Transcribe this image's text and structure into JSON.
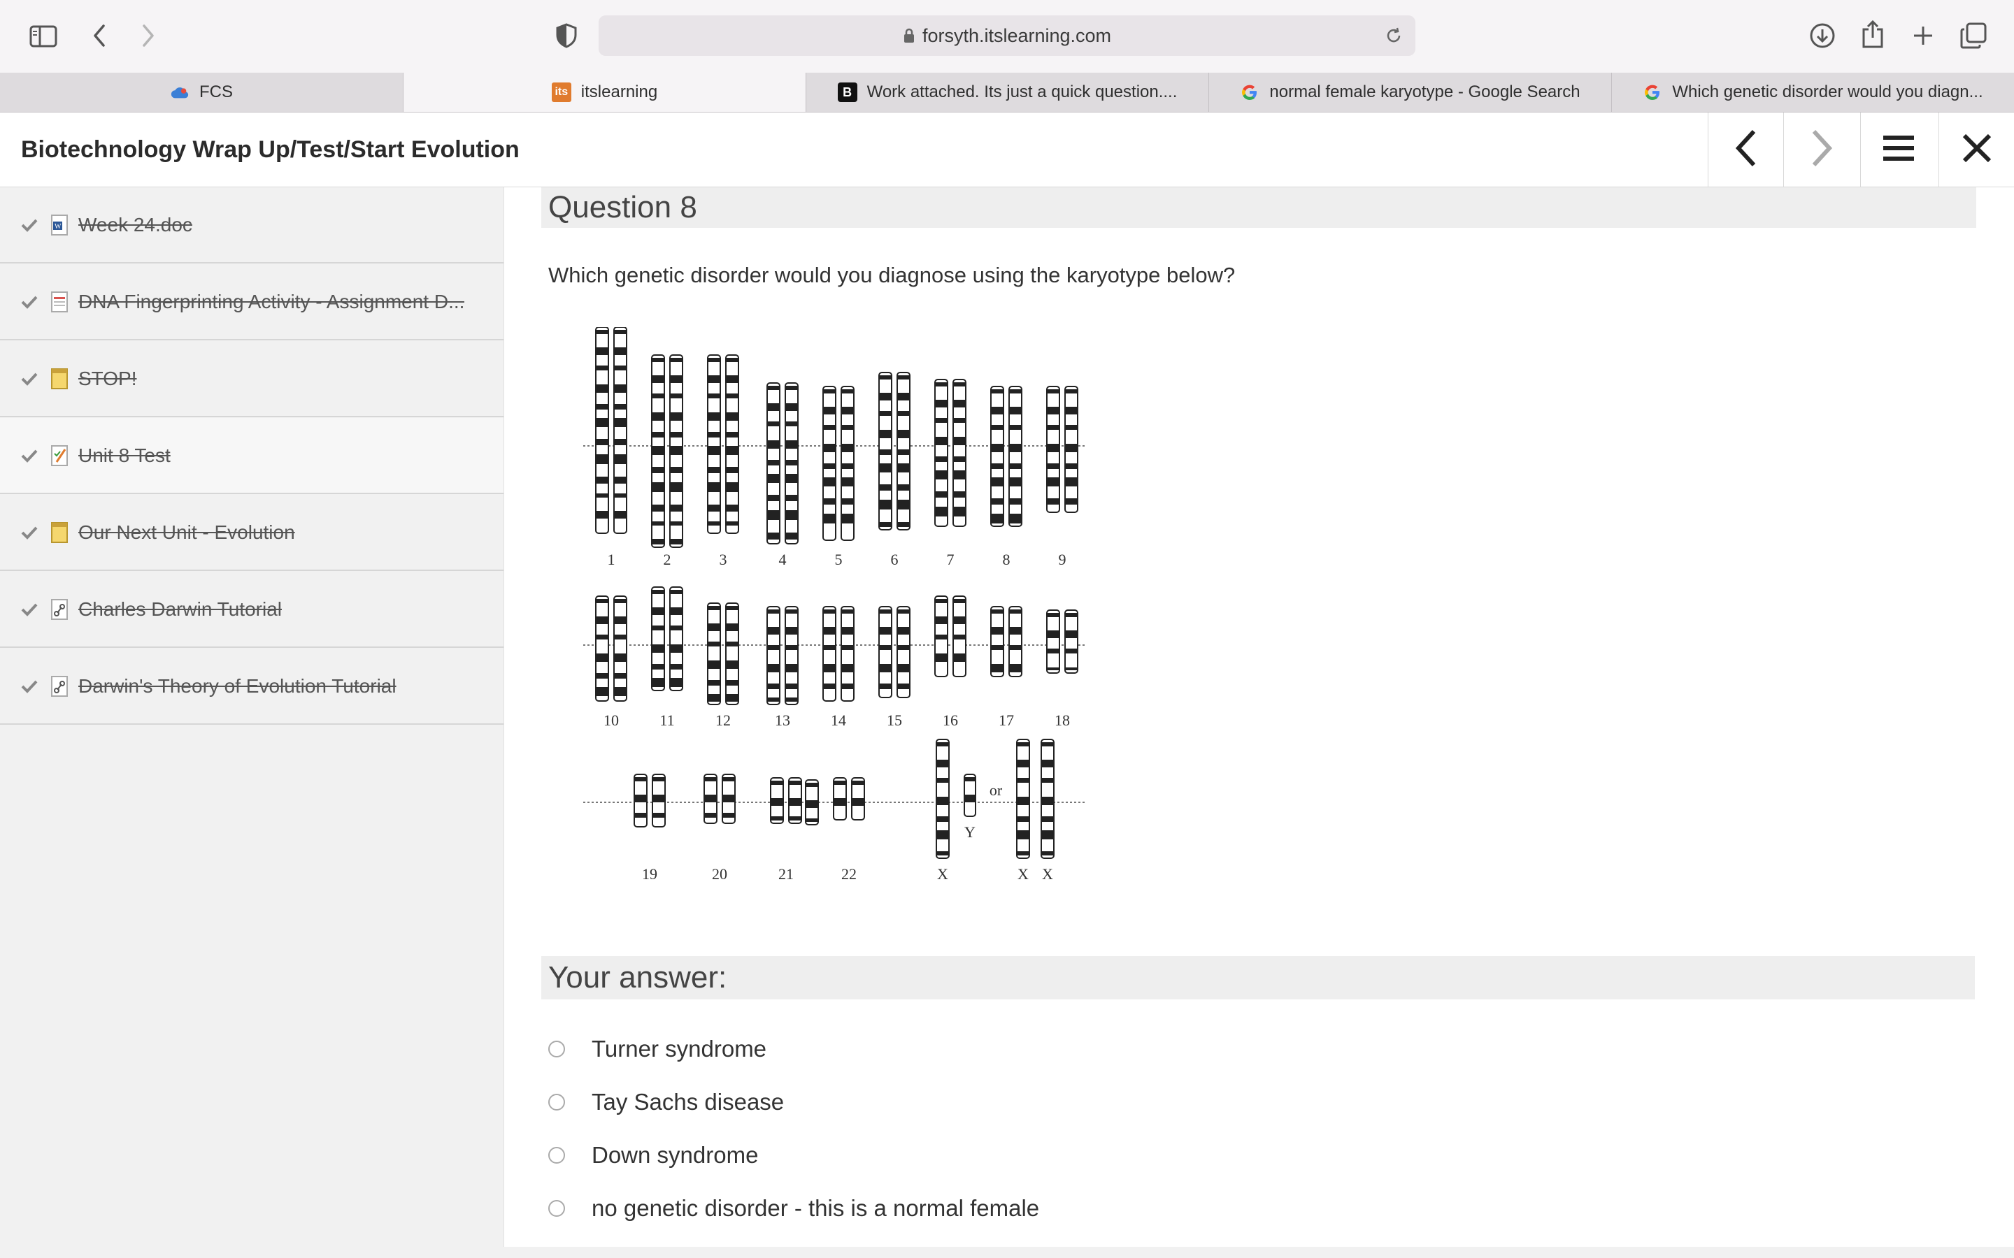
{
  "browser": {
    "url": "forsyth.itslearning.com",
    "tabs": [
      {
        "label": "FCS",
        "icon": "cloud-icon"
      },
      {
        "label": "itslearning",
        "icon": "itslearning-icon",
        "active": true
      },
      {
        "label": "Work attached. Its just a quick question....",
        "icon": "brainly-icon"
      },
      {
        "label": "normal female karyotype - Google Search",
        "icon": "google-icon"
      },
      {
        "label": "Which genetic disorder would you diagn...",
        "icon": "google-icon"
      }
    ]
  },
  "header": {
    "title": "Biotechnology Wrap Up/Test/Start Evolution"
  },
  "sidebar": {
    "items": [
      {
        "label": "Week 24.doc",
        "icon": "word-doc-icon",
        "completed": true
      },
      {
        "label": "DNA Fingerprinting Activity - Assignment D...",
        "icon": "pdf-doc-icon",
        "completed": true
      },
      {
        "label": "STOP!",
        "icon": "note-icon",
        "completed": true
      },
      {
        "label": "Unit 8 Test",
        "icon": "test-icon",
        "completed": true
      },
      {
        "label": "Our Next Unit - Evolution",
        "icon": "note-icon",
        "completed": true
      },
      {
        "label": "Charles Darwin Tutorial",
        "icon": "link-icon",
        "completed": true
      },
      {
        "label": "Darwin's Theory of Evolution Tutorial",
        "icon": "link-icon",
        "completed": true
      }
    ]
  },
  "question": {
    "heading": "Question 8",
    "text": "Which genetic disorder would you diagnose using the karyotype below?",
    "karyotype_labels": {
      "row1": [
        "1",
        "2",
        "3",
        "4",
        "5",
        "6",
        "7",
        "8",
        "9"
      ],
      "row2": [
        "10",
        "11",
        "12",
        "13",
        "14",
        "15",
        "16",
        "17",
        "18"
      ],
      "row3": [
        "19",
        "20",
        "21",
        "22",
        "X",
        "X",
        "X"
      ],
      "y_label": "Y",
      "or_label": "or"
    }
  },
  "answer": {
    "heading": "Your answer:",
    "options": [
      "Turner syndrome",
      "Tay Sachs disease",
      "Down syndrome",
      "no genetic disorder - this is a normal female"
    ]
  },
  "colors": {
    "itslearning_orange": "#e07b2e",
    "sidebar_bg": "#f1f1f1",
    "section_bar_bg": "#eeeeee"
  }
}
